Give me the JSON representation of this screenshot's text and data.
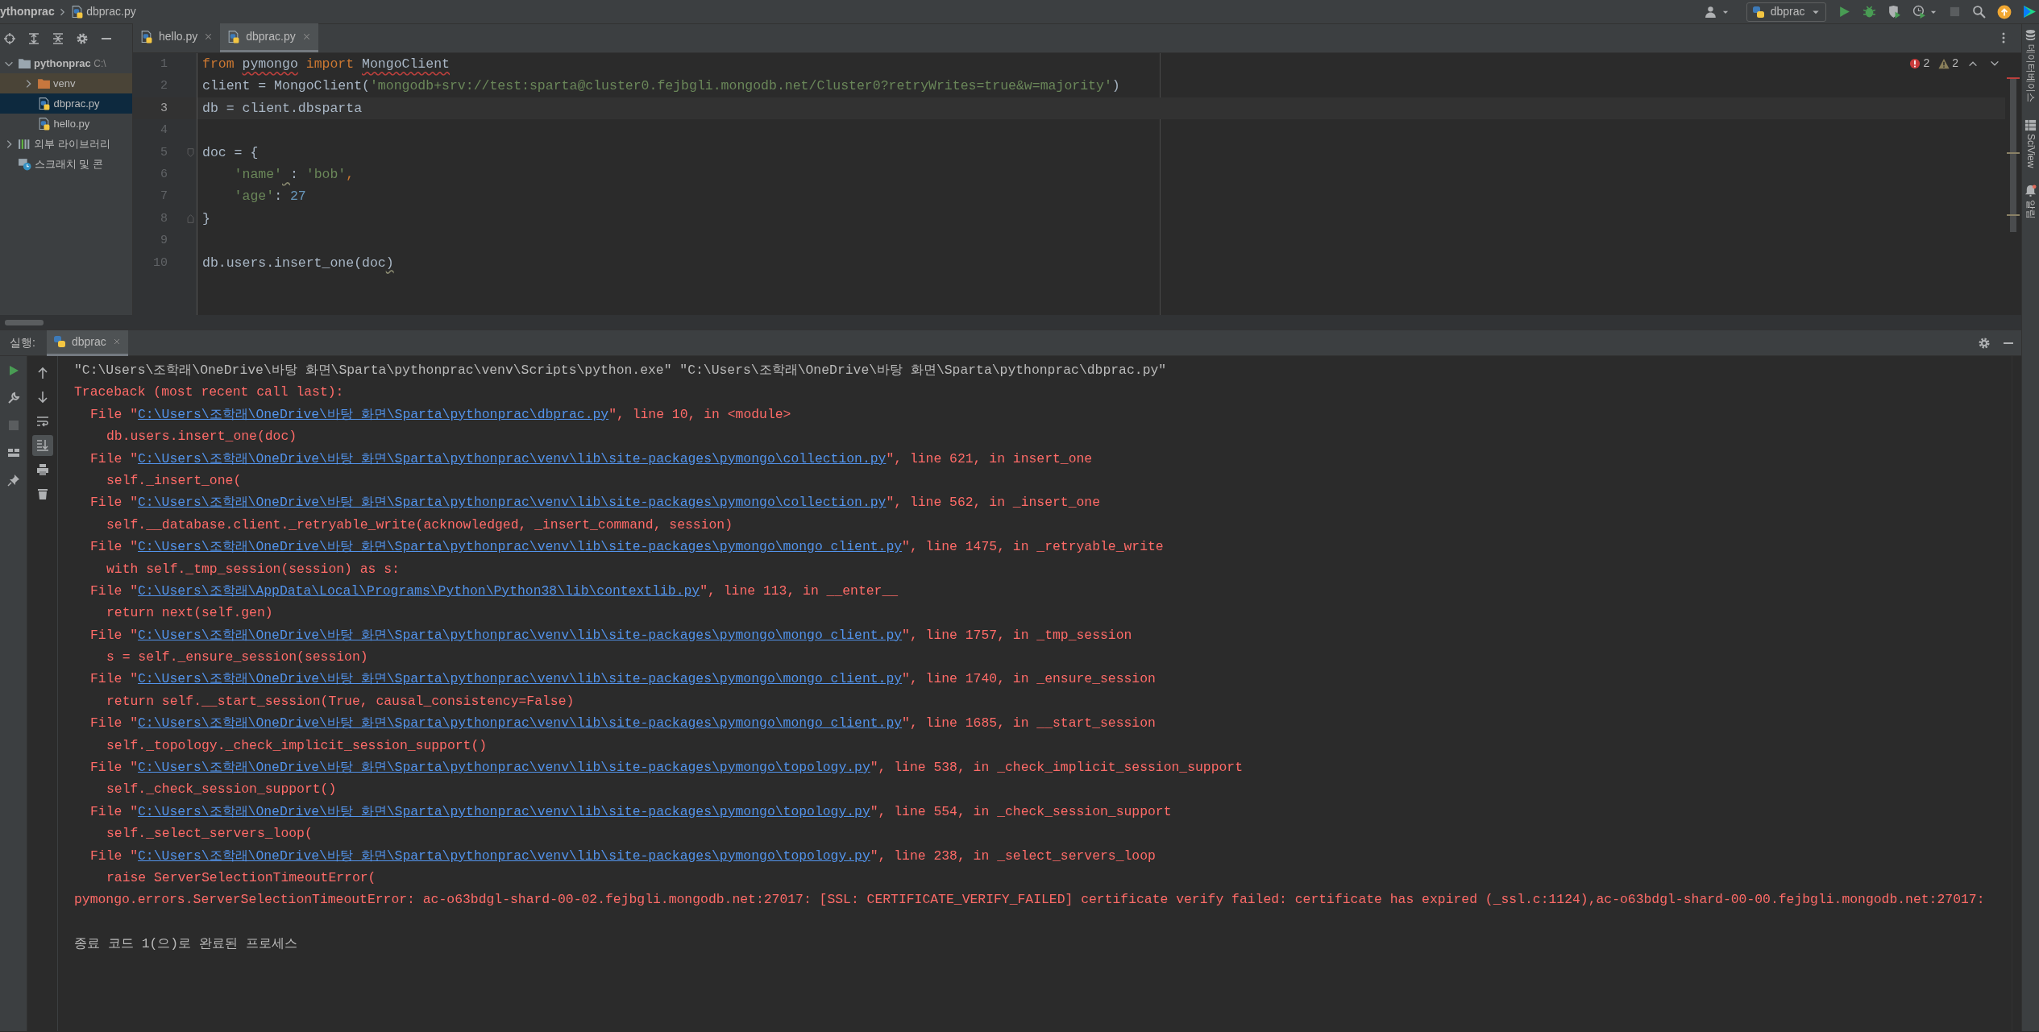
{
  "breadcrumb": [
    {
      "kind": "project",
      "text": "ythonprac"
    },
    {
      "kind": "file",
      "text": "dbprac.py"
    }
  ],
  "run_config": {
    "label": "dbprac"
  },
  "project_tree": [
    {
      "kind": "project",
      "label": "pythonprac",
      "hint": "C:\\",
      "expanded": true,
      "selected": false,
      "excluded": false,
      "children": [
        {
          "kind": "folder",
          "label": "venv",
          "expanded": false,
          "selected": false,
          "excluded": true
        },
        {
          "kind": "file",
          "label": "dbprac.py",
          "selected": true,
          "excluded": false
        },
        {
          "kind": "file",
          "label": "hello.py",
          "selected": false,
          "excluded": false
        }
      ]
    },
    {
      "kind": "library",
      "label": "외부 라이브러리",
      "expanded": false,
      "selected": false,
      "excluded": false
    },
    {
      "kind": "scratch",
      "label": "스크래치 및 콘",
      "selected": false,
      "excluded": false
    }
  ],
  "editor_tabs": [
    {
      "label": "hello.py",
      "selected": false
    },
    {
      "label": "dbprac.py",
      "selected": true
    }
  ],
  "inspections": {
    "errors": "2",
    "warnings": "2"
  },
  "editor_lines": [
    {
      "number": "1",
      "current": false,
      "tokens": [
        {
          "t": "from ",
          "kind": "keyword"
        },
        {
          "t": "pymongo",
          "error": true
        },
        {
          "t": " import ",
          "kind": "keyword"
        },
        {
          "t": "MongoClient",
          "error": true
        }
      ]
    },
    {
      "number": "2",
      "current": false,
      "tokens": [
        {
          "t": "client = MongoClient("
        },
        {
          "t": "'mongodb+srv://test:sparta@cluster0.fejbgli.mongodb.net/Cluster0?retryWrites=true&w=majority'",
          "kind": "string"
        },
        {
          "t": ")"
        }
      ]
    },
    {
      "number": "3",
      "current": true,
      "tokens": [
        {
          "t": "db = client.dbsparta"
        }
      ]
    },
    {
      "number": "4",
      "current": false
    },
    {
      "number": "5",
      "current": false,
      "fold_start": true,
      "tokens": [
        {
          "t": "doc = {"
        }
      ]
    },
    {
      "number": "6",
      "current": false,
      "tokens": [
        {
          "t": "    'name'",
          "kind": "string",
          "warning_after": true
        },
        {
          "t": ": "
        },
        {
          "t": "'bob'",
          "kind": "string"
        },
        {
          "t": ",",
          "kind": "keyword"
        }
      ]
    },
    {
      "number": "7",
      "current": false,
      "tokens": [
        {
          "t": "    'age'",
          "kind": "string"
        },
        {
          "t": ": "
        },
        {
          "t": "27",
          "kind": "number"
        }
      ]
    },
    {
      "number": "8",
      "current": false,
      "fold_end": true,
      "tokens": [
        {
          "t": "}"
        }
      ]
    },
    {
      "number": "9",
      "current": false
    },
    {
      "number": "10",
      "current": false,
      "tokens": [
        {
          "t": "db.users.insert_one(doc"
        },
        {
          "t": ")",
          "warning": true
        }
      ]
    }
  ],
  "side_stripe": [
    {
      "kind": "database",
      "label": "데이터베이스"
    },
    {
      "kind": "sciview",
      "label": "SciView"
    },
    {
      "kind": "bell",
      "label": "알림"
    }
  ],
  "run_panel": {
    "label": "실행:",
    "tab": "dbprac",
    "scroll_to_end": true,
    "soft_wrap": false
  },
  "console": [
    {
      "kind": "command",
      "text": "\"C:\\Users\\조학래\\OneDrive\\바탕 화면\\Sparta\\pythonprac\\venv\\Scripts\\python.exe\" \"C:\\Users\\조학래\\OneDrive\\바탕 화면\\Sparta\\pythonprac\\dbprac.py\""
    },
    {
      "kind": "error",
      "text": "Traceback (most recent call last):"
    },
    {
      "kind": "frame",
      "before": "File \"",
      "link": "C:\\Users\\조학래\\OneDrive\\바탕 화면\\Sparta\\pythonprac\\dbprac.py",
      "after": "\", line 10, in <module>"
    },
    {
      "kind": "code",
      "text": "db.users.insert_one(doc)"
    },
    {
      "kind": "frame",
      "before": "File \"",
      "link": "C:\\Users\\조학래\\OneDrive\\바탕 화면\\Sparta\\pythonprac\\venv\\lib\\site-packages\\pymongo\\collection.py",
      "after": "\", line 621, in insert_one"
    },
    {
      "kind": "code",
      "text": "self._insert_one("
    },
    {
      "kind": "frame",
      "before": "File \"",
      "link": "C:\\Users\\조학래\\OneDrive\\바탕 화면\\Sparta\\pythonprac\\venv\\lib\\site-packages\\pymongo\\collection.py",
      "after": "\", line 562, in _insert_one"
    },
    {
      "kind": "code",
      "text": "self.__database.client._retryable_write(acknowledged, _insert_command, session)"
    },
    {
      "kind": "frame",
      "before": "File \"",
      "link": "C:\\Users\\조학래\\OneDrive\\바탕 화면\\Sparta\\pythonprac\\venv\\lib\\site-packages\\pymongo\\mongo_client.py",
      "after": "\", line 1475, in _retryable_write"
    },
    {
      "kind": "code",
      "text": "with self._tmp_session(session) as s:"
    },
    {
      "kind": "frame",
      "before": "File \"",
      "link": "C:\\Users\\조학래\\AppData\\Local\\Programs\\Python\\Python38\\lib\\contextlib.py",
      "after": "\", line 113, in __enter__"
    },
    {
      "kind": "code",
      "text": "return next(self.gen)"
    },
    {
      "kind": "frame",
      "before": "File \"",
      "link": "C:\\Users\\조학래\\OneDrive\\바탕 화면\\Sparta\\pythonprac\\venv\\lib\\site-packages\\pymongo\\mongo_client.py",
      "after": "\", line 1757, in _tmp_session"
    },
    {
      "kind": "code",
      "text": "s = self._ensure_session(session)"
    },
    {
      "kind": "frame",
      "before": "File \"",
      "link": "C:\\Users\\조학래\\OneDrive\\바탕 화면\\Sparta\\pythonprac\\venv\\lib\\site-packages\\pymongo\\mongo_client.py",
      "after": "\", line 1740, in _ensure_session"
    },
    {
      "kind": "code",
      "text": "return self.__start_session(True, causal_consistency=False)"
    },
    {
      "kind": "frame",
      "before": "File \"",
      "link": "C:\\Users\\조학래\\OneDrive\\바탕 화면\\Sparta\\pythonprac\\venv\\lib\\site-packages\\pymongo\\mongo_client.py",
      "after": "\", line 1685, in __start_session"
    },
    {
      "kind": "code",
      "text": "self._topology._check_implicit_session_support()"
    },
    {
      "kind": "frame",
      "before": "File \"",
      "link": "C:\\Users\\조학래\\OneDrive\\바탕 화면\\Sparta\\pythonprac\\venv\\lib\\site-packages\\pymongo\\topology.py",
      "after": "\", line 538, in _check_implicit_session_support"
    },
    {
      "kind": "code",
      "text": "self._check_session_support()"
    },
    {
      "kind": "frame",
      "before": "File \"",
      "link": "C:\\Users\\조학래\\OneDrive\\바탕 화면\\Sparta\\pythonprac\\venv\\lib\\site-packages\\pymongo\\topology.py",
      "after": "\", line 554, in _check_session_support"
    },
    {
      "kind": "code",
      "text": "self._select_servers_loop("
    },
    {
      "kind": "frame",
      "before": "File \"",
      "link": "C:\\Users\\조학래\\OneDrive\\바탕 화면\\Sparta\\pythonprac\\venv\\lib\\site-packages\\pymongo\\topology.py",
      "after": "\", line 238, in _select_servers_loop"
    },
    {
      "kind": "code",
      "text": "raise ServerSelectionTimeoutError("
    },
    {
      "kind": "error",
      "text": "pymongo.errors.ServerSelectionTimeoutError: ac-o63bdgl-shard-00-02.fejbgli.mongodb.net:27017: [SSL: CERTIFICATE_VERIFY_FAILED] certificate verify failed: certificate has expired (_ssl.c:1124),ac-o63bdgl-shard-00-00.fejbgli.mongodb.net:27017:"
    },
    {
      "kind": "exit",
      "text": "종료 코드 1(으)로 완료된 프로세스"
    }
  ]
}
